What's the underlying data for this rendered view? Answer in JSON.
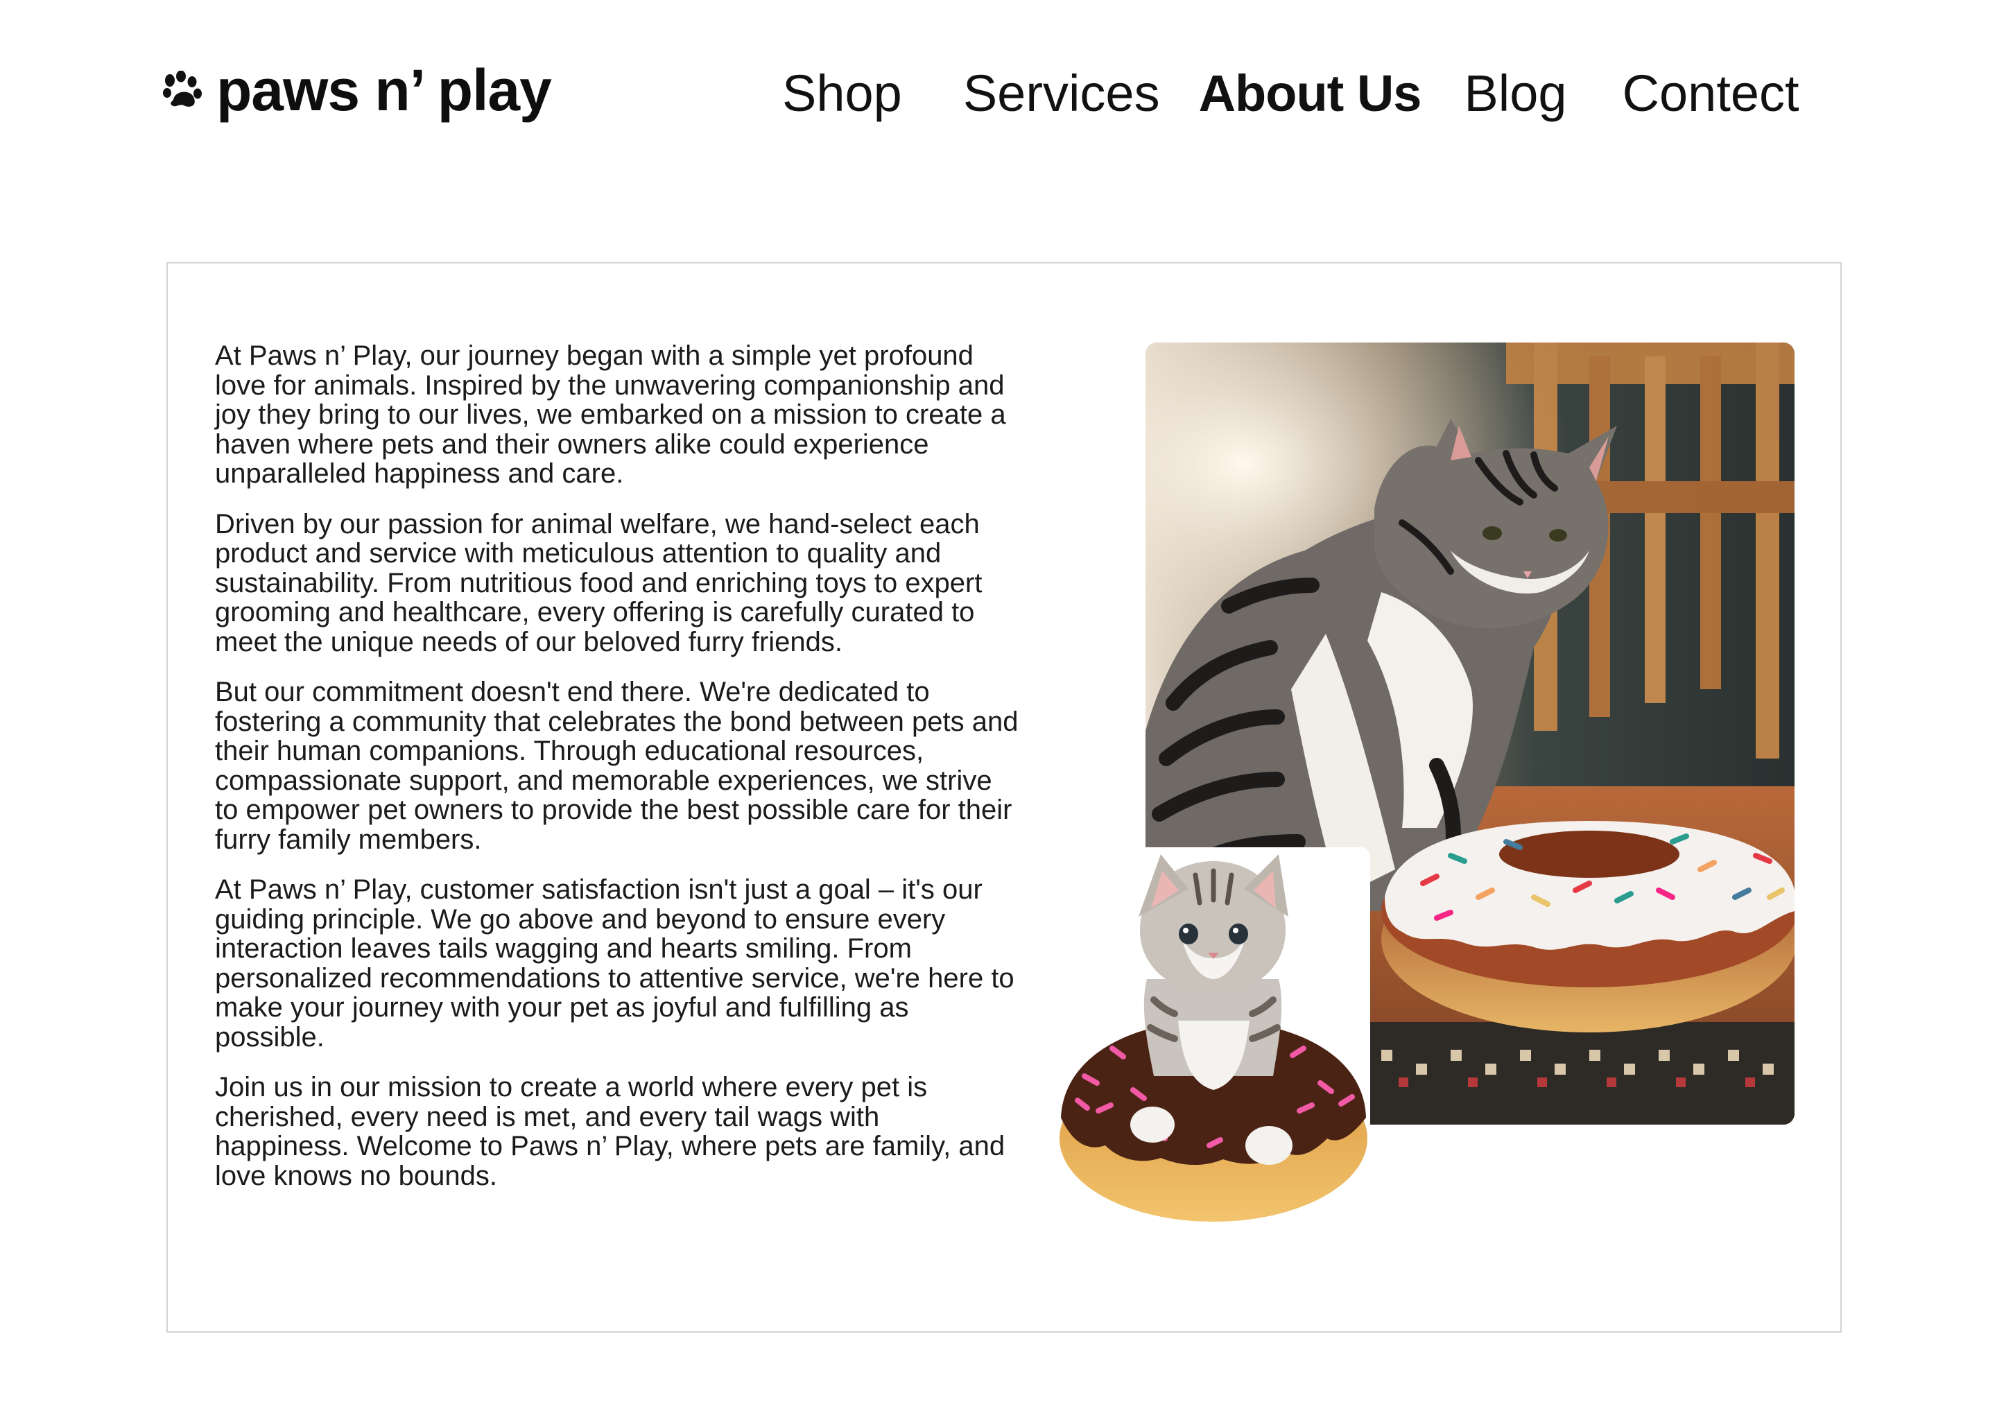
{
  "brand": {
    "name": "paws n’ play",
    "logo_icon": "paw-print-icon"
  },
  "nav": {
    "items": [
      {
        "label": "Shop",
        "active": false
      },
      {
        "label": "Services",
        "active": false
      },
      {
        "label": "About Us",
        "active": true
      },
      {
        "label": "Blog",
        "active": false
      },
      {
        "label": "Contect",
        "active": false
      }
    ]
  },
  "about": {
    "paragraphs": [
      "At Paws n’ Play, our journey began with a simple yet profound love for animals. Inspired by the unwavering companionship and joy they bring to our lives, we embarked on a mission to create a haven where pets and their owners alike could experience unparalleled happiness and care.",
      "Driven by our passion for animal welfare, we hand-select each product and service with meticulous attention to quality and sustainability. From nutritious food and enriching toys to expert grooming and healthcare, every offering is carefully curated to meet the unique needs of our beloved furry friends.",
      "But our commitment doesn't end there. We're dedicated to fostering a community that celebrates the bond between pets and their human companions. Through educational resources, compassionate support, and memorable experiences, we strive to empower pet owners to provide the best possible care for their furry family members.",
      "At Paws n’ Play, customer satisfaction isn't just a goal – it's our guiding principle. We go above and beyond to ensure every interaction leaves tails wagging and hearts smiling. From personalized recommendations to attentive service, we're here to make your journey with your pet as joyful and fulfilling as possible.",
      "Join us in our mission to create a world where every pet is cherished, every need is met, and every tail wags with happiness. Welcome to Paws n’ Play, where pets are family, and love knows no bounds."
    ]
  },
  "colors": {
    "text": "#111111",
    "card_border": "#d4d4d4",
    "background": "#ffffff"
  }
}
